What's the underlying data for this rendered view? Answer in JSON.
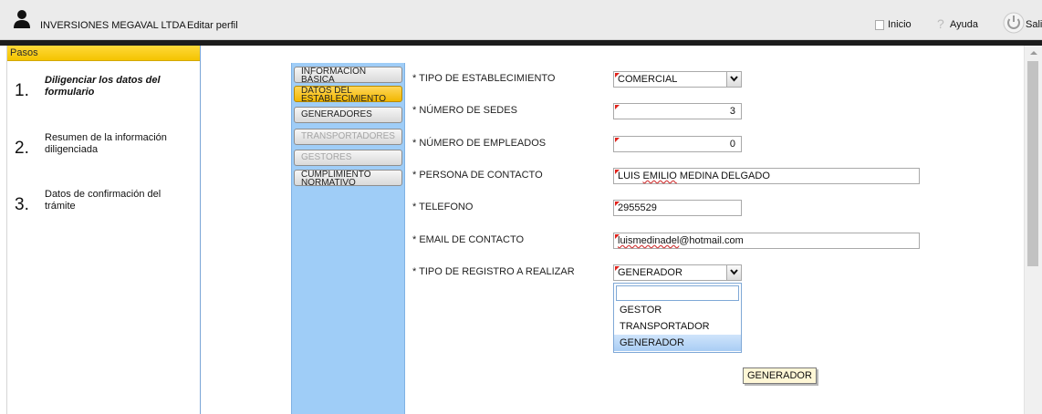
{
  "header": {
    "company": "INVERSIONES MEGAVAL LTDA",
    "edit_profile": "Editar perfil",
    "nav": [
      {
        "label": "Inicio",
        "icon": "home-icon"
      },
      {
        "label": "Ayuda",
        "icon": "help-icon"
      },
      {
        "label": "Sali",
        "icon": "power-icon"
      }
    ]
  },
  "sidebar": {
    "title": "Pasos",
    "steps": [
      {
        "num": "1.",
        "text": "Diligenciar los datos del formulario",
        "active": true
      },
      {
        "num": "2.",
        "text": "Resumen de la información diligenciada",
        "active": false
      },
      {
        "num": "3.",
        "text": "Datos de confirmación del trámite",
        "active": false
      }
    ]
  },
  "tabs": [
    {
      "label": "INFORMACION BÁSICA",
      "state": "normal"
    },
    {
      "label": "DATOS DEL ESTABLECIMIENTO",
      "state": "active"
    },
    {
      "label": "GENERADORES",
      "state": "normal"
    },
    {
      "label": "TRANSPORTADORES",
      "state": "disabled"
    },
    {
      "label": "GESTORES",
      "state": "disabled"
    },
    {
      "label": "CUMPLIMIENTO NORMATIVO",
      "state": "normal"
    }
  ],
  "form": {
    "tipo_establecimiento": {
      "label": "* TIPO DE ESTABLECIMIENTO",
      "value": "COMERCIAL"
    },
    "numero_sedes": {
      "label": "* NÚMERO DE SEDES",
      "value": "3"
    },
    "numero_empleados": {
      "label": "* NÚMERO DE EMPLEADOS",
      "value": "0"
    },
    "persona_contacto": {
      "label": "* PERSONA DE CONTACTO",
      "value": "LUIS EMILIO MEDINA DELGADO"
    },
    "telefono": {
      "label": "* TELEFONO",
      "value": "2955529"
    },
    "email": {
      "label": "* EMAIL DE CONTACTO",
      "value": "luismedinadel@hotmail.com"
    },
    "tipo_registro": {
      "label": "* TIPO DE REGISTRO A REALIZAR",
      "value": "GENERADOR"
    }
  },
  "dropdown": {
    "filter_value": "",
    "options": [
      "GESTOR",
      "TRANSPORTADOR",
      "GENERADOR"
    ],
    "selected": "GENERADOR"
  },
  "tooltip": "GENERADOR",
  "colors": {
    "accent_yellow": "#f4c400",
    "tab_column": "#9fcdf7",
    "required_flag": "#e0231c"
  }
}
